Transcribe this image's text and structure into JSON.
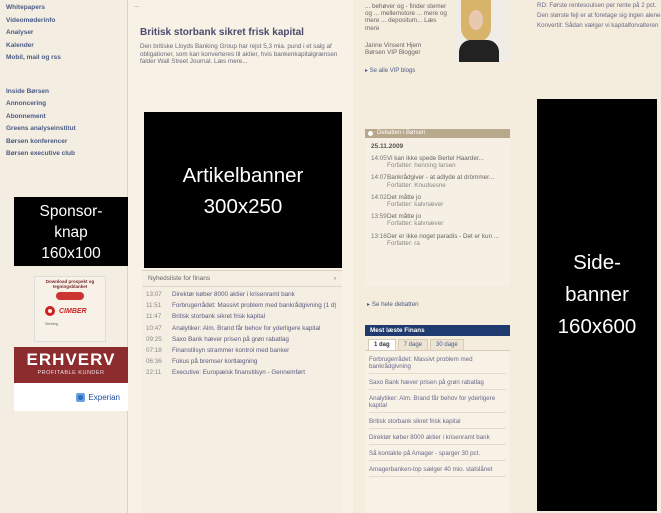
{
  "left_nav": {
    "group1": [
      "Whitepapers",
      "Videomøderinfo",
      "Analyser",
      "Kalender",
      "Mobil, mail og rss"
    ],
    "group2": [
      "Inside Børsen",
      "Annoncering",
      "Abonnement",
      "Greens analyseinstitut",
      "Børsen konferencer",
      "Børsen executive club"
    ]
  },
  "sponsor_placeholder": {
    "line1": "Sponsor-",
    "line2": "knap",
    "line3": "160x100"
  },
  "ad_cimber": {
    "top": "Download prospekt og tegningsblanket",
    "logo": "CIMBER",
    "small": "Sterling"
  },
  "ad_erhverv": {
    "title": "ERHVERV",
    "subtitle": "PROFITABLE KUNDER",
    "partner": "Experian"
  },
  "main": {
    "crumb": "...",
    "headline": "Britisk storbank sikret frisk kapital",
    "lead": "Den britiske Lloyds Banking Group har rejst 5,3 mia. pund i et salg af obligationer, som kan konverteres til aktier, hvis bankenkapitalgrænsen falder Wall Street Journal. Læs mere...",
    "article_banner": {
      "line1": "Artikelbanner",
      "line2": "300x250"
    },
    "news_header": "Nyhedsliste for finans",
    "news_marker": "›",
    "news": [
      {
        "time": "13:07",
        "text": "Direktør køber 8000 aktier i krisenramt bank"
      },
      {
        "time": "11:51",
        "text": "Forbrugerrådet: Massivt problem med bankrådgivning (1 d)"
      },
      {
        "time": "11:47",
        "text": "Britisk storbank sikret frisk kapital"
      },
      {
        "time": "10:47",
        "text": "Analytiker: Alm. Brand får behov for yderligere kapital"
      },
      {
        "time": "09:25",
        "text": "Saxo Bank hæver prisen på grøn rabatlag"
      },
      {
        "time": "07:18",
        "text": "Finanstilsyn strammer kontrol med banker"
      },
      {
        "time": "06:36",
        "text": "Fokus på bremser kortlægning"
      },
      {
        "time": "22:11",
        "text": "Executive: Europæisk finanstilsyn - Gennemført"
      }
    ]
  },
  "mid": {
    "intro": "... behøver og - finder stemer og ... mellemstore ... mere og mere ... depositum... Læs mere",
    "blogger_name": "Janne Vinsent Hjem",
    "blogger_title": "Børsen VIP Blogger",
    "all_vip": "▸ Se alle VIP blogs",
    "debate_title": "Debatten i Børsen",
    "debate_date": "25.11.2009",
    "debate": [
      {
        "time": "14:05",
        "text": "Vi kan ikke spede Bertel Haarder...",
        "author": "Forfatter: henning larsen"
      },
      {
        "time": "14:07",
        "text": "Bankrådgiver - at adlyde at drömmer...",
        "author": "Forfatter: Knudsesne"
      },
      {
        "time": "14:02",
        "text": "Det måtte jo",
        "author": "Forfatter: kalvnæver"
      },
      {
        "time": "13:59",
        "text": "Det måtte jo",
        "author": "Forfatter: kalvnæver"
      },
      {
        "time": "13:16",
        "text": "Der er ikke noget paradis - Det er kun ...",
        "author": "Forfatter: ra"
      }
    ],
    "all_debate": "▸ Se hele debatten",
    "most_read_title": "Mest læste Finans",
    "tabs": [
      "1 dag",
      "7 dage",
      "30 dage"
    ],
    "most_read": [
      "Forbrugerrådet: Massivt problem med bankrådgivning",
      "Saxo Bank hæver prisen på grøn rabatlag",
      "Analytiker: Alm. Brand får behov for yderligere kapital",
      "Britisk storbank sikret frisk kapital",
      "Direktør køber 8000 aktier i krisenramt bank",
      "Så kontakte på Amager - sparger 30 pct.",
      "Amagerbanken-top sælger 40 mio. statslånet"
    ]
  },
  "right": {
    "list": [
      "RD: Første rentesoulsen per rente på 2 pct.",
      "Den største fejl er at foretage sig ingen alene",
      "Konvertit: Sådan vælger vi kapitalforvalteren"
    ],
    "side_banner": {
      "line1": "Side-",
      "line2": "banner",
      "line3": "160x600"
    }
  }
}
